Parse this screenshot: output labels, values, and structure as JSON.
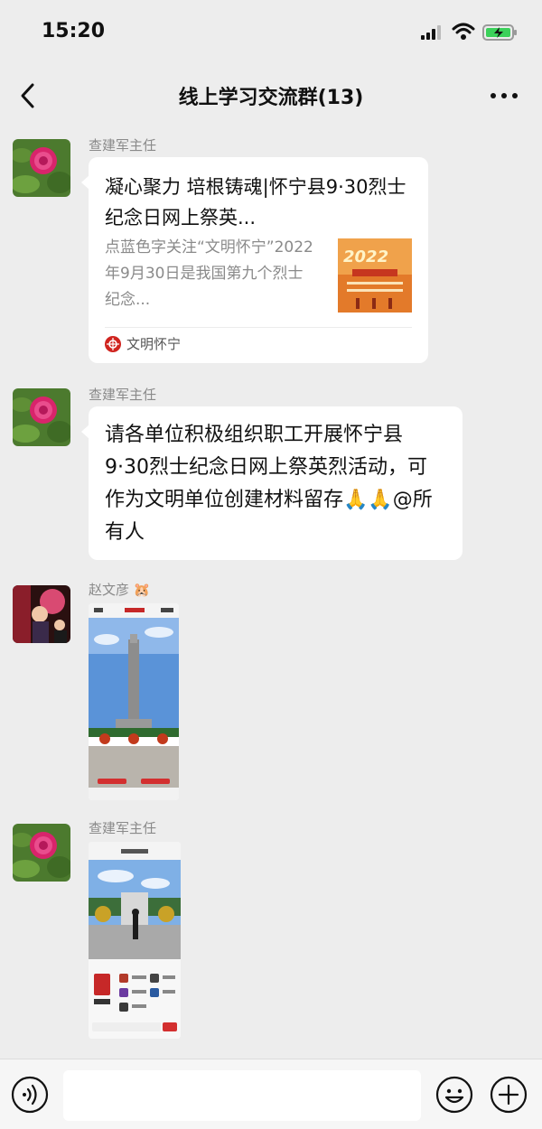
{
  "status_bar": {
    "time": "15:20"
  },
  "header": {
    "title": "线上学习交流群(13)",
    "back_icon": "chevron-left-icon",
    "more_icon": "more-dots-icon"
  },
  "messages": [
    {
      "type": "link-card",
      "sender": "查建军主任",
      "title": "凝心聚力 培根铸魂|怀宁县9·30烈士纪念日网上祭英...",
      "description": "点蓝色字关注“文明怀宁”2022年9月30日是我国第九个烈士纪念...",
      "thumb_year": "2022",
      "source": "文明怀宁"
    },
    {
      "type": "text",
      "sender": "查建军主任",
      "text": "请各单位积极组织职工开展怀宁县9·30烈士纪念日网上祭英烈活动，可作为文明单位创建材料留存🙏🙏@所有人"
    },
    {
      "type": "image",
      "sender": "赵文彦",
      "sender_emoji": "🐹"
    },
    {
      "type": "image",
      "sender": "查建军主任"
    }
  ],
  "input_bar": {
    "placeholder": "",
    "voice_icon": "voice-icon",
    "emoji_icon": "emoji-icon",
    "plus_icon": "plus-icon"
  },
  "colors": {
    "background": "#ededed",
    "bubble": "#ffffff",
    "sender": "#8a8a8a",
    "accent_red": "#c8281e"
  }
}
